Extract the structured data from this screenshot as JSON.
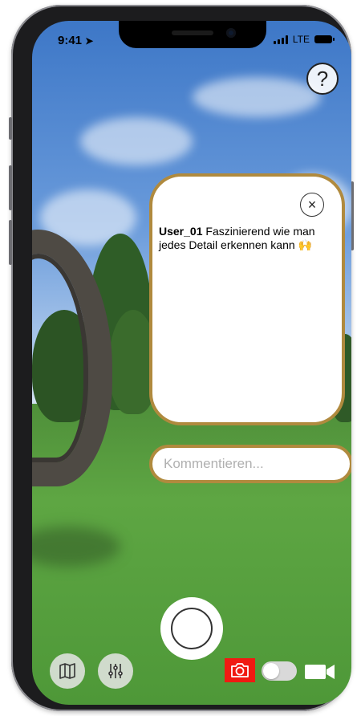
{
  "status_bar": {
    "time": "9:41",
    "network": "LTE"
  },
  "help": {
    "label": "?"
  },
  "comment": {
    "close_label": "×",
    "user": "User_01",
    "text": " Faszinierend wie man jedes Detail erkennen kann ",
    "emoji": "🙌"
  },
  "comment_input": {
    "placeholder": "Kommentieren...",
    "value": ""
  },
  "toolbar": {
    "map_icon": "map-icon",
    "filter_icon": "sliders-icon",
    "photo_icon": "camera-icon",
    "video_icon": "video-camera-icon",
    "mode_toggle": "photo"
  },
  "colors": {
    "card_border": "#b08a3e",
    "photo_active": "#f01a12"
  }
}
